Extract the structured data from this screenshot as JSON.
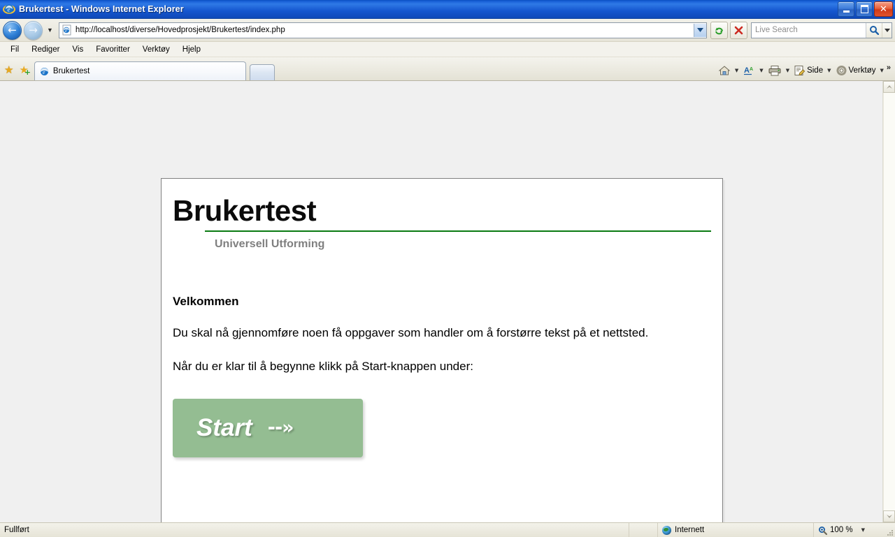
{
  "window": {
    "title": "Brukertest - Windows Internet Explorer",
    "buttons": {
      "minimize": "minimize-icon",
      "maximize": "maximize-icon",
      "close": "✕"
    }
  },
  "navigation": {
    "back": "←",
    "forward": "→",
    "history_caret": "▼",
    "address": {
      "value": "http://localhost/diverse/Hovedprosjekt/Brukertest/index.php",
      "dropdown_caret": "⌄"
    },
    "refresh_icon": "refresh-icon",
    "stop_icon": "✕",
    "search": {
      "placeholder": "Live Search",
      "value": "",
      "go_icon": "search-icon",
      "caret": "▼"
    }
  },
  "menubar": {
    "items": [
      {
        "label": "Fil"
      },
      {
        "label": "Rediger"
      },
      {
        "label": "Vis"
      },
      {
        "label": "Favoritter"
      },
      {
        "label": "Verktøy"
      },
      {
        "label": "Hjelp"
      }
    ]
  },
  "tabbar": {
    "favorites_icon": "★",
    "add_favorite_icon": "★",
    "add_favorite_plus": "+",
    "tabs": [
      {
        "label": "Brukertest",
        "active": true
      }
    ],
    "new_tab_label": "",
    "tools": [
      {
        "name": "home",
        "label": "",
        "caret": "▼"
      },
      {
        "name": "text-size",
        "label": "",
        "caret": "▼"
      },
      {
        "name": "print",
        "label": "",
        "caret": "▼"
      },
      {
        "name": "page",
        "label": "Side",
        "caret": "▼"
      },
      {
        "name": "tools",
        "label": "Verktøy",
        "caret": "▼"
      }
    ],
    "overflow": "»"
  },
  "page": {
    "brand_title": "Brukertest",
    "brand_subtitle": "Universell Utforming",
    "heading": "Velkommen",
    "paragraph1": "Du skal nå gjennomføre noen få oppgaver som handler om å forstørre tekst på et nettsted.",
    "paragraph2": "Når du er klar til å begynne klikk på Start-knappen under:",
    "start_button": {
      "label": "Start",
      "arrow": "--»"
    },
    "colors": {
      "rule": "#0a7a12",
      "button": "#94bd92",
      "subtitle": "#7f7f7f"
    }
  },
  "scrollbar": {
    "up": "▲",
    "down": "▼"
  },
  "statusbar": {
    "status": "Fullført",
    "zone": "Internett",
    "zoom": "100 %",
    "zoom_caret": "▼"
  }
}
